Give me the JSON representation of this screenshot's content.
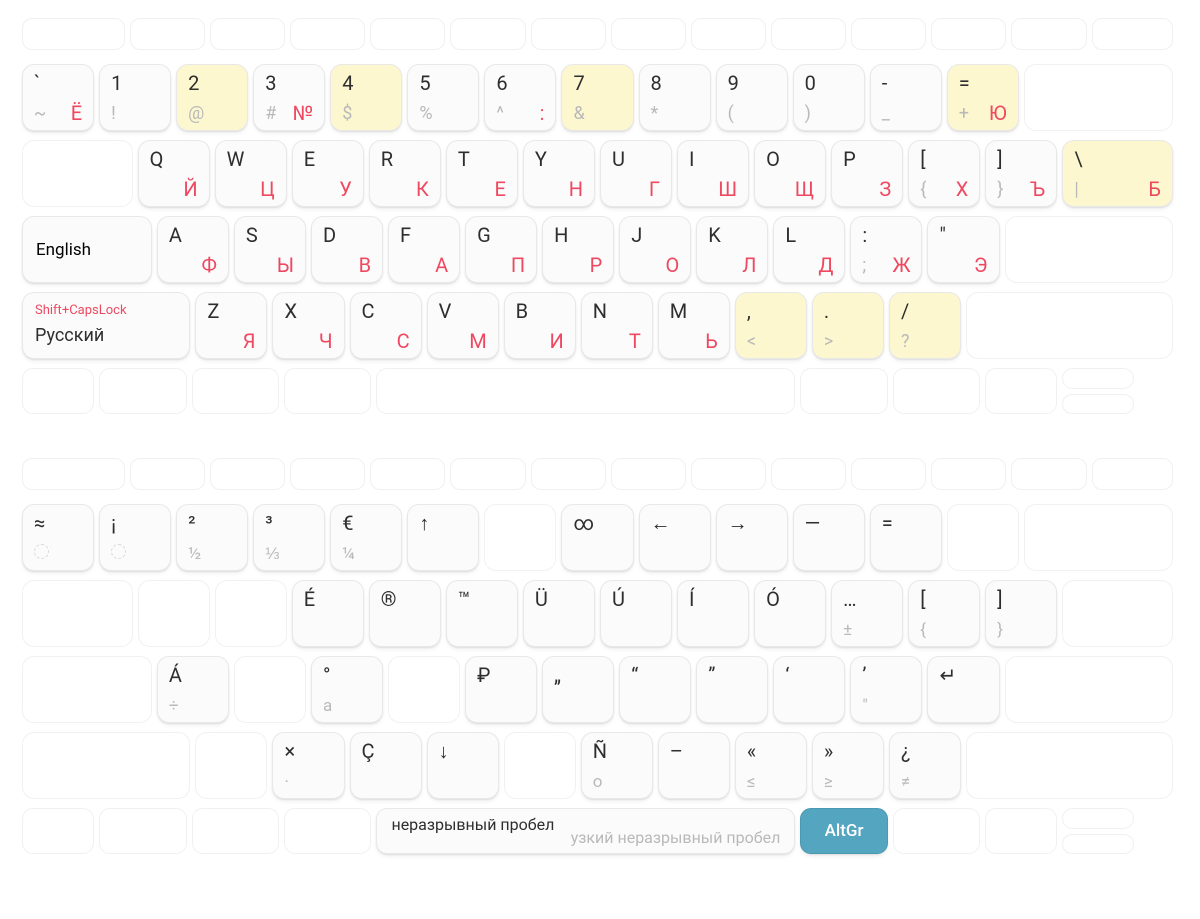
{
  "kb1": {
    "fn_count": 14,
    "row_num": [
      {
        "tl": "`",
        "bl": "~",
        "br": "Ё"
      },
      {
        "tl": "1",
        "bl": "!"
      },
      {
        "tl": "2",
        "bl": "@",
        "hl": true
      },
      {
        "tl": "3",
        "bl": "#",
        "br": "№"
      },
      {
        "tl": "4",
        "bl": "$",
        "hl": true
      },
      {
        "tl": "5",
        "bl": "%"
      },
      {
        "tl": "6",
        "bl": "^",
        "br": ":"
      },
      {
        "tl": "7",
        "bl": "&",
        "hl": true
      },
      {
        "tl": "8",
        "bl": "*"
      },
      {
        "tl": "9",
        "bl": "("
      },
      {
        "tl": "0",
        "bl": ")"
      },
      {
        "tl": "-",
        "bl": "_"
      },
      {
        "tl": "=",
        "bl": "+",
        "br": "Ю",
        "hl": true
      }
    ],
    "row_q": [
      {
        "tl": "Q",
        "br": "Й"
      },
      {
        "tl": "W",
        "br": "Ц"
      },
      {
        "tl": "E",
        "br": "У"
      },
      {
        "tl": "R",
        "br": "К"
      },
      {
        "tl": "T",
        "br": "Е"
      },
      {
        "tl": "Y",
        "br": "Н"
      },
      {
        "tl": "U",
        "br": "Г"
      },
      {
        "tl": "I",
        "br": "Ш"
      },
      {
        "tl": "O",
        "br": "Щ"
      },
      {
        "tl": "P",
        "br": "З"
      },
      {
        "tl": "[",
        "bl": "{",
        "br": "Х"
      },
      {
        "tl": "]",
        "bl": "}",
        "br": "Ъ"
      },
      {
        "tl": "\\",
        "bl": "|",
        "br": "Б",
        "hl": true
      }
    ],
    "caps": {
      "label": "English"
    },
    "row_a": [
      {
        "tl": "A",
        "br": "Ф"
      },
      {
        "tl": "S",
        "br": "Ы"
      },
      {
        "tl": "D",
        "br": "В"
      },
      {
        "tl": "F",
        "br": "А"
      },
      {
        "tl": "G",
        "br": "П"
      },
      {
        "tl": "H",
        "br": "Р"
      },
      {
        "tl": "J",
        "br": "О"
      },
      {
        "tl": "K",
        "br": "Л"
      },
      {
        "tl": "L",
        "br": "Д"
      },
      {
        "tl": ":",
        "bl": ";",
        "br": "Ж"
      },
      {
        "tl": "\"",
        "br": "Э"
      }
    ],
    "shift": {
      "line1": "Shift+CapsLock",
      "line2": "Русский"
    },
    "row_z": [
      {
        "tl": "Z",
        "br": "Я"
      },
      {
        "tl": "X",
        "br": "Ч"
      },
      {
        "tl": "C",
        "br": "С"
      },
      {
        "tl": "V",
        "br": "М"
      },
      {
        "tl": "B",
        "br": "И"
      },
      {
        "tl": "N",
        "br": "Т"
      },
      {
        "tl": "M",
        "br": "Ь"
      },
      {
        "tl": ",",
        "bl": "<",
        "hl": true
      },
      {
        "tl": ".",
        "bl": ">",
        "hl": true
      },
      {
        "tl": "/",
        "bl": "?",
        "hl": true
      }
    ]
  },
  "kb2": {
    "fn_count": 14,
    "row_num": [
      {
        "tl": "≈",
        "bl_dead": true
      },
      {
        "tl": "¡",
        "bl_dead": true
      },
      {
        "tl": "²",
        "bl": "½"
      },
      {
        "tl": "³",
        "bl": "⅓"
      },
      {
        "tl": "€",
        "bl": "¼"
      },
      {
        "tl": "↑"
      },
      {
        "empty": true
      },
      {
        "tl": "∞"
      },
      {
        "tl": "←"
      },
      {
        "tl": "→"
      },
      {
        "tl": "—"
      },
      {
        "tl": "="
      },
      {
        "empty": true
      }
    ],
    "row_q": [
      {
        "empty": true
      },
      {
        "empty": true
      },
      {
        "tl": "É"
      },
      {
        "tl": "®"
      },
      {
        "tl": "™"
      },
      {
        "tl": "Ü"
      },
      {
        "tl": "Ú"
      },
      {
        "tl": "Í"
      },
      {
        "tl": "Ó"
      },
      {
        "tl": "…",
        "bl": "±"
      },
      {
        "tl": "[",
        "bl": "{"
      },
      {
        "tl": "]",
        "bl": "}"
      },
      {
        "empty": true
      }
    ],
    "row_a": [
      {
        "tl": "Á",
        "bl": "÷"
      },
      {
        "empty": true
      },
      {
        "tl": "°",
        "bl": "a"
      },
      {
        "empty": true
      },
      {
        "tl": "₽"
      },
      {
        "tl": "„"
      },
      {
        "tl": "“"
      },
      {
        "tl": "”"
      },
      {
        "tl": "‘"
      },
      {
        "tl": "’",
        "bl": "\""
      },
      {
        "tl": "↵"
      }
    ],
    "row_z": [
      {
        "empty": true
      },
      {
        "tl": "×",
        "bl": "·"
      },
      {
        "tl": "Ç"
      },
      {
        "tl": "↓"
      },
      {
        "empty": true
      },
      {
        "tl": "Ñ",
        "bl": "o"
      },
      {
        "tl": "–"
      },
      {
        "tl": "«",
        "bl": "≤"
      },
      {
        "tl": "»",
        "bl": "≥"
      },
      {
        "tl": "¿",
        "bl": "≠"
      }
    ],
    "space": {
      "top": "неразрывный пробел",
      "bot": "узкий неразрывный пробел"
    },
    "altgr": "AltGr"
  }
}
